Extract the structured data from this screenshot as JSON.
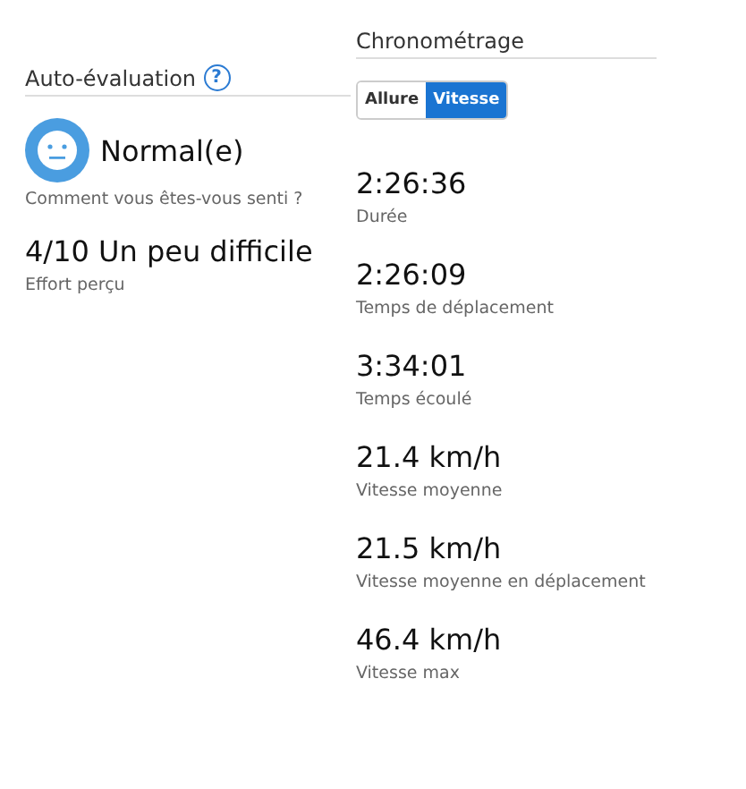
{
  "self_evaluation": {
    "title": "Auto-évaluation",
    "help_icon": "?",
    "feeling": {
      "value": "Normal(e)",
      "label": "Comment vous êtes-vous senti ?"
    },
    "effort": {
      "value": "4/10 Un peu difficile",
      "label": "Effort perçu"
    }
  },
  "timing": {
    "title": "Chronométrage",
    "tabs": [
      {
        "label": "Allure",
        "selected": false
      },
      {
        "label": "Vitesse",
        "selected": true
      }
    ],
    "stats": [
      {
        "value": "2:26:36",
        "label": "Durée"
      },
      {
        "value": "2:26:09",
        "label": "Temps de déplacement"
      },
      {
        "value": "3:34:01",
        "label": "Temps écoulé"
      },
      {
        "value": "21.4 km/h",
        "label": "Vitesse moyenne"
      },
      {
        "value": "21.5 km/h",
        "label": "Vitesse moyenne en déplacement"
      },
      {
        "value": "46.4 km/h",
        "label": "Vitesse max"
      }
    ]
  }
}
